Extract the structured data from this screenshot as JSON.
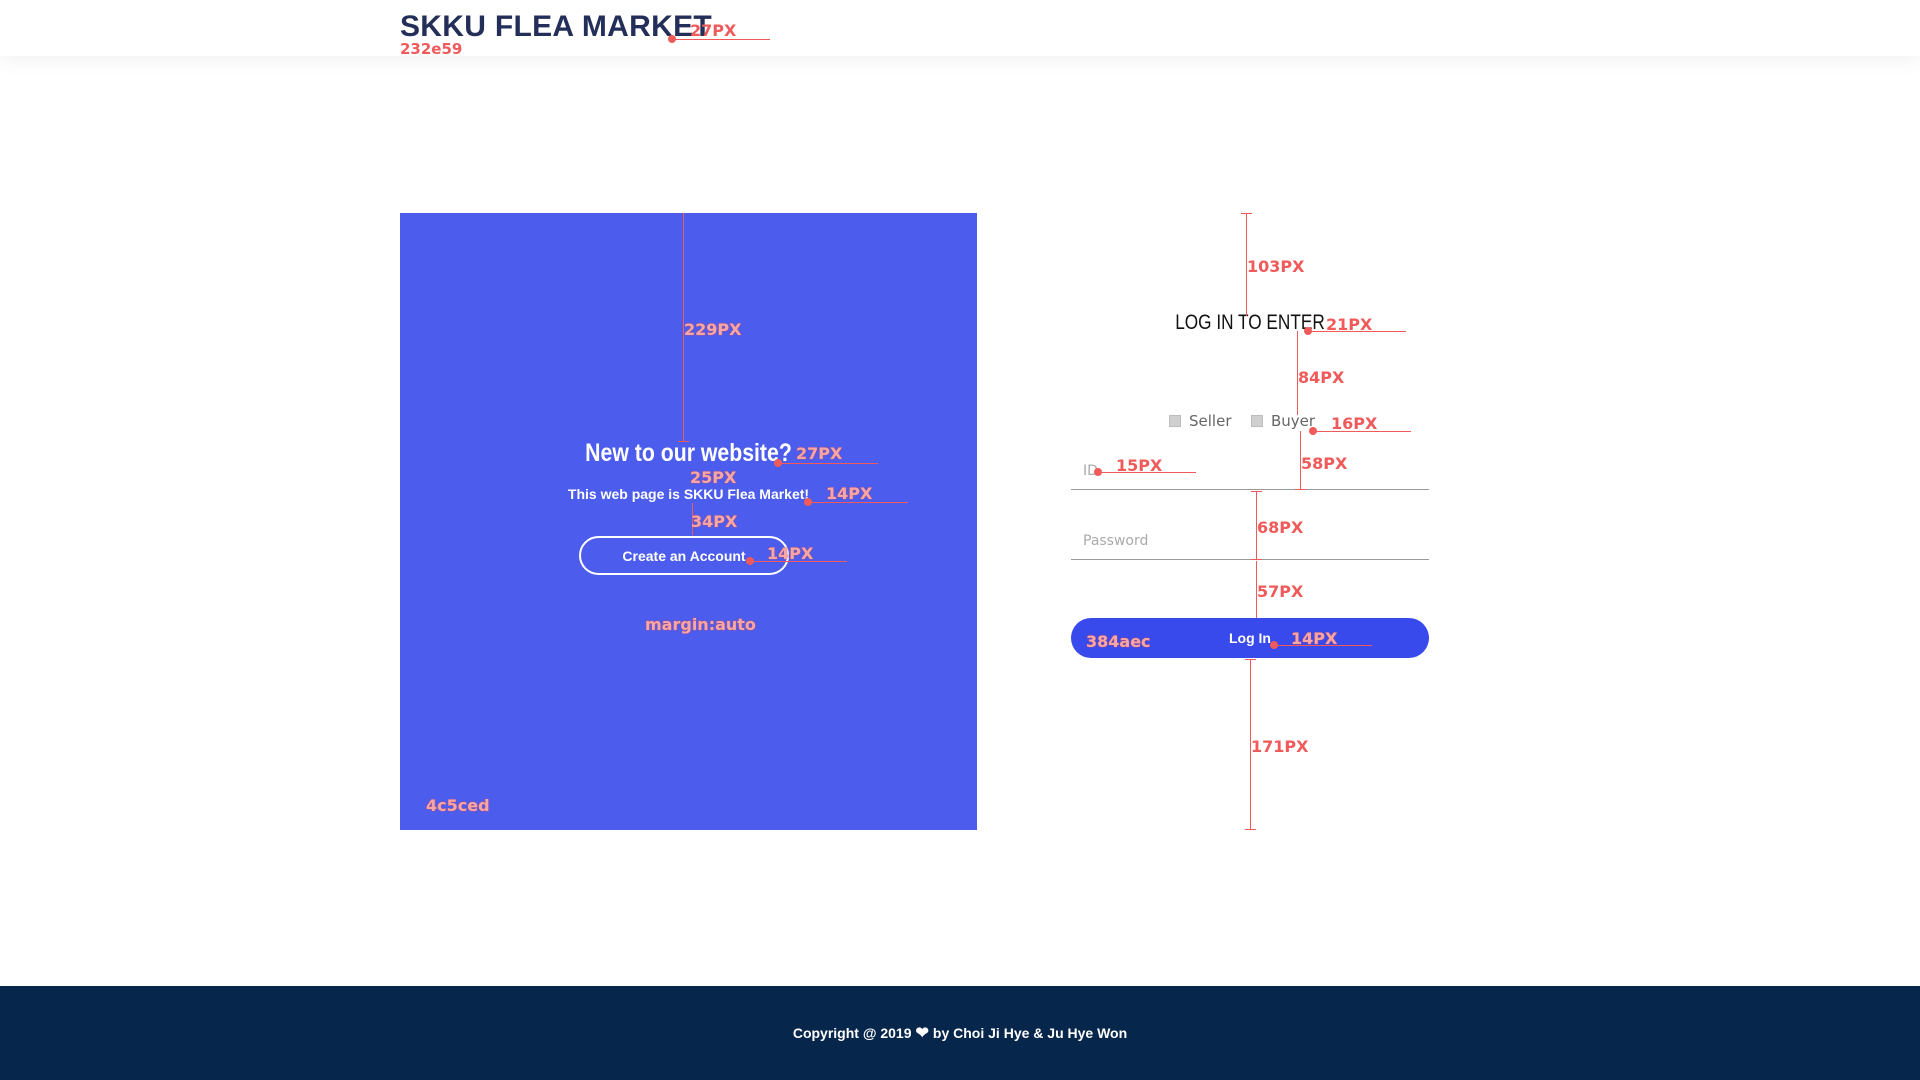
{
  "header": {
    "brand": "SKKU FLEA MARKET",
    "brand_size_note": "27PX",
    "brand_color_note": "232e59"
  },
  "panel": {
    "title": "New to our website?",
    "subtitle": "This web page is SKKU Flea Market!",
    "create_button": "Create an Account",
    "notes": {
      "top_gap": "229PX",
      "title_size": "27PX",
      "title_gap": "25PX",
      "subtitle_size": "14PX",
      "button_gap": "34PX",
      "button_size": "14PX",
      "margin": "margin:auto",
      "bg_color": "4c5ced"
    }
  },
  "login": {
    "title": "LOG IN TO ENTER",
    "role_seller": "Seller",
    "role_buyer": "Buyer",
    "id_placeholder": "ID",
    "password_placeholder": "Password",
    "login_button": "Log In",
    "notes": {
      "top_gap": "103PX",
      "title_size": "21PX",
      "title_gap": "84PX",
      "role_size": "16PX",
      "role_gap": "58PX",
      "id_size": "15PX",
      "field_gap": "68PX",
      "button_gap": "57PX",
      "button_color": "384aec",
      "button_size": "14PX",
      "bottom_gap": "171PX"
    }
  },
  "footer": {
    "text_before": "Copyright @ 2019",
    "text_after": "by Choi Ji Hye & Ju Hye Won"
  },
  "colors": {
    "brand": "#232e59",
    "panel": "#4c5ced",
    "login_button": "#384aec",
    "footer": "#07264b",
    "annotation": "#f05a5a"
  }
}
